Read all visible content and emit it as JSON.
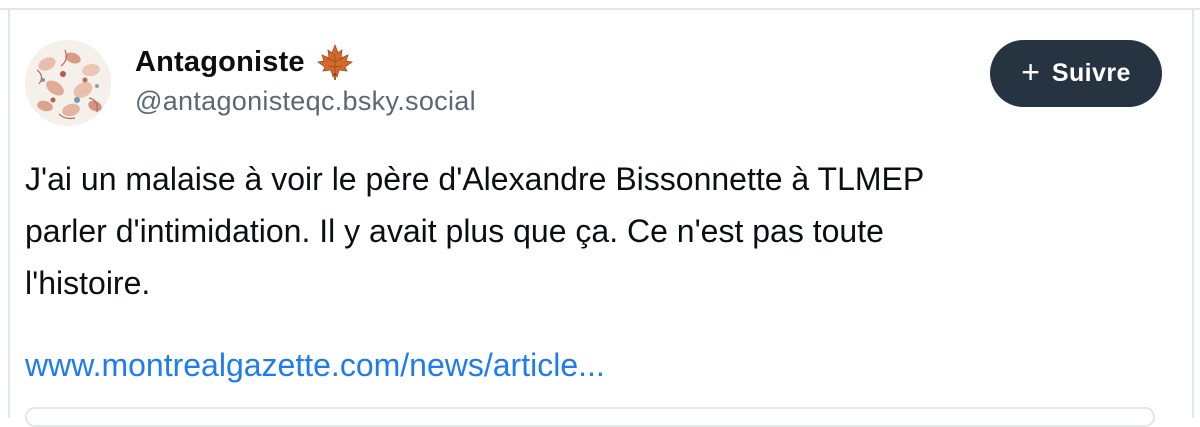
{
  "author": {
    "display_name": "Antagoniste",
    "handle": "@antagonisteqc.bsky.social",
    "badge_icon": "maple-leaf-icon",
    "avatar_icon": "avatar-illustration"
  },
  "follow_button": {
    "icon": "plus-icon",
    "plus": "+",
    "label": "Suivre"
  },
  "post": {
    "lines": [
      "J'ai un malaise à voir le père d'Alexandre Bissonnette à TLMEP",
      "parler d'intimidation. Il y avait plus que ça. Ce n'est pas toute",
      "l'histoire."
    ],
    "link_text": "www.montrealgazette.com/news/article..."
  },
  "colors": {
    "accent_link": "#1f7bf2",
    "button_bg": "#263340",
    "text": "#0b0f14",
    "muted": "#5b6874"
  }
}
